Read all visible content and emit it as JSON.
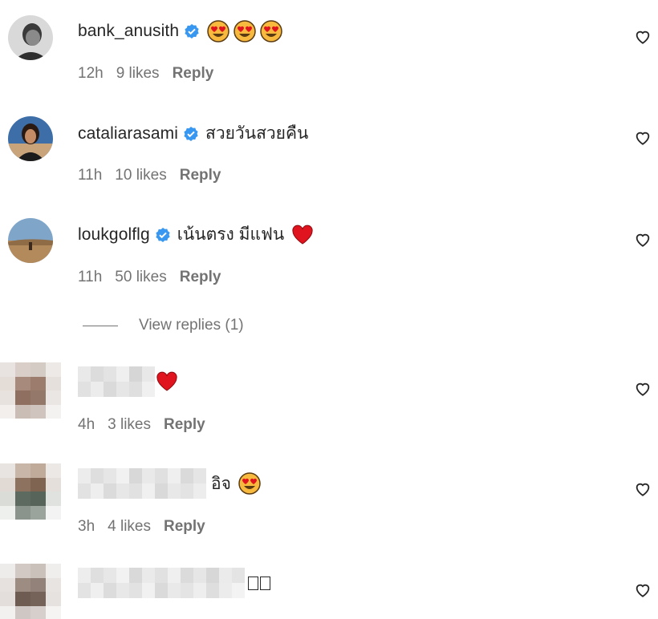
{
  "comments": [
    {
      "username": "bank_anusith",
      "verified": true,
      "text": "",
      "emojis": [
        "heart-eyes-emoji",
        "heart-eyes-emoji",
        "heart-eyes-emoji"
      ],
      "time": "12h",
      "likes": "9 likes",
      "reply": "Reply"
    },
    {
      "username": "cataliarasami",
      "verified": true,
      "text": "สวยวันสวยคืน",
      "emojis": [],
      "time": "11h",
      "likes": "10 likes",
      "reply": "Reply"
    },
    {
      "username": "loukgolflg",
      "verified": true,
      "text": "เน้นตรง มีแฟน",
      "emojis": [
        "red-heart-emoji"
      ],
      "time": "11h",
      "likes": "50 likes",
      "reply": "Reply"
    },
    {
      "username": "",
      "verified": false,
      "text": "",
      "emojis": [
        "red-heart-emoji"
      ],
      "time": "4h",
      "likes": "3 likes",
      "reply": "Reply"
    },
    {
      "username": "",
      "verified": false,
      "text": "อิจ",
      "emojis": [
        "heart-eyes-emoji"
      ],
      "time": "3h",
      "likes": "4 likes",
      "reply": "Reply"
    },
    {
      "username": "",
      "verified": false,
      "text": "",
      "emojis": [],
      "time": "",
      "likes": "",
      "reply": ""
    }
  ],
  "view_replies": "View replies (1)",
  "colors": {
    "verified": "#3897f0",
    "meta": "#737373",
    "text": "#262626",
    "red_heart": "#e0141e"
  }
}
